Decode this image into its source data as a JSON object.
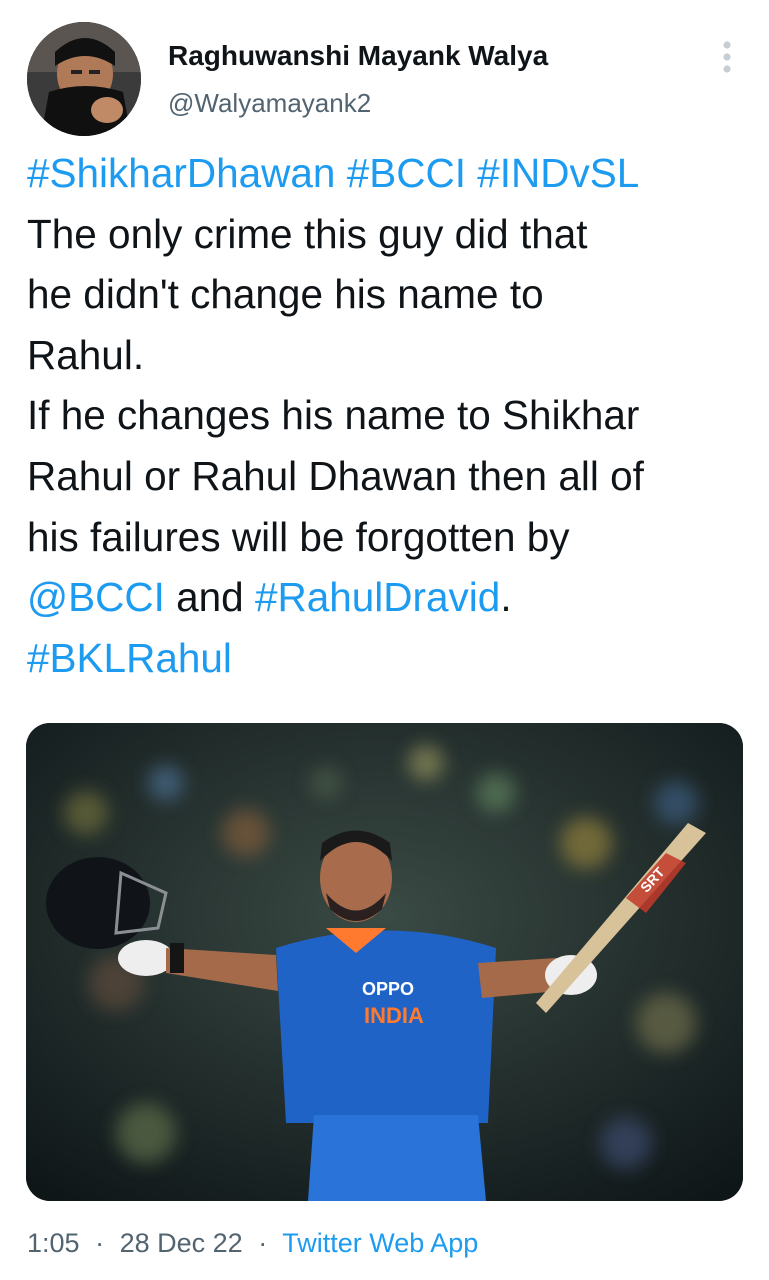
{
  "author": {
    "name": "Raghuwanshi Mayank Walya",
    "handle": "@Walyamayank2"
  },
  "tweet": {
    "lines": [
      [
        {
          "text": "#ShikharDhawan",
          "link": true
        },
        {
          "text": " ",
          "link": false
        },
        {
          "text": "#BCCI",
          "link": true
        },
        {
          "text": " ",
          "link": false
        },
        {
          "text": "#INDvSL",
          "link": true
        }
      ],
      [
        {
          "text": "The only crime this guy did that",
          "link": false
        }
      ],
      [
        {
          "text": "he didn't change his name to",
          "link": false
        }
      ],
      [
        {
          "text": "Rahul.",
          "link": false
        }
      ],
      [
        {
          "text": "If he changes his name to Shikhar",
          "link": false
        }
      ],
      [
        {
          "text": "Rahul or Rahul Dhawan then all of",
          "link": false
        }
      ],
      [
        {
          "text": "his failures will be forgotten by",
          "link": false
        }
      ],
      [
        {
          "text": "@BCCI",
          "link": true
        },
        {
          "text": " and ",
          "link": false
        },
        {
          "text": "#RahulDravid",
          "link": true
        },
        {
          "text": ".",
          "link": false
        }
      ],
      [
        {
          "text": "#BKLRahul",
          "link": true
        }
      ]
    ]
  },
  "media": {
    "jersey_brand": "OPPO",
    "jersey_country": "INDIA",
    "bat_brand": "SRT"
  },
  "meta": {
    "time": "1:05",
    "date": "28 Dec 22",
    "separator": "·",
    "source": "Twitter Web App"
  },
  "colors": {
    "link": "#1d9bf0",
    "secondary_text": "#536471",
    "jersey_blue": "#1f63c7"
  },
  "icons": {
    "more": "more-vertical-icon"
  }
}
